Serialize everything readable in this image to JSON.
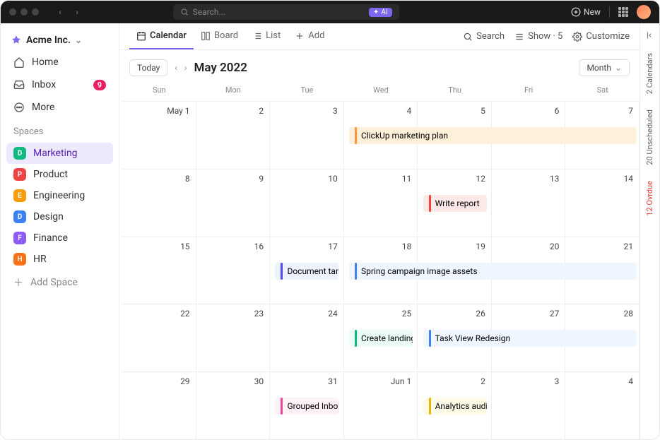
{
  "titlebar": {
    "search_placeholder": "Search...",
    "ai_label": "AI",
    "new_label": "New"
  },
  "workspace": {
    "name": "Acme Inc."
  },
  "sidebar": {
    "items": [
      {
        "label": "Home",
        "icon": "home"
      },
      {
        "label": "Inbox",
        "icon": "inbox",
        "badge": "9"
      },
      {
        "label": "More",
        "icon": "more"
      }
    ],
    "section_label": "Spaces",
    "spaces": [
      {
        "letter": "D",
        "label": "Marketing",
        "color": "#10b981",
        "active": true
      },
      {
        "letter": "P",
        "label": "Product",
        "color": "#ef4444"
      },
      {
        "letter": "E",
        "label": "Engineering",
        "color": "#f59e0b"
      },
      {
        "letter": "D",
        "label": "Design",
        "color": "#3b82f6"
      },
      {
        "letter": "F",
        "label": "Finance",
        "color": "#8b5cf6"
      },
      {
        "letter": "H",
        "label": "HR",
        "color": "#f97316"
      }
    ],
    "add_space": "Add Space"
  },
  "tabs": {
    "items": [
      {
        "label": "Calendar",
        "icon": "calendar",
        "active": true
      },
      {
        "label": "Board",
        "icon": "board"
      },
      {
        "label": "List",
        "icon": "list"
      },
      {
        "label": "Add",
        "icon": "plus"
      }
    ],
    "search": "Search",
    "show": "Show · 5",
    "customize": "Customize"
  },
  "calendar": {
    "today": "Today",
    "title": "May 2022",
    "view": "Month",
    "dow": [
      "Sun",
      "Mon",
      "Tue",
      "Wed",
      "Thu",
      "Fri",
      "Sat"
    ],
    "weeks": [
      [
        "May 1",
        "2",
        "3",
        "4",
        "5",
        "6",
        "7"
      ],
      [
        "8",
        "9",
        "10",
        "11",
        "12",
        "13",
        "14"
      ],
      [
        "15",
        "16",
        "17",
        "18",
        "19",
        "20",
        "21"
      ],
      [
        "22",
        "23",
        "24",
        "25",
        "26",
        "27",
        "28"
      ],
      [
        "29",
        "30",
        "31",
        "Jun 1",
        "2",
        "3",
        "4"
      ]
    ],
    "events": [
      {
        "week": 0,
        "start": 3,
        "span": 4,
        "label": "ClickUp marketing plan",
        "bg": "#fff0d9",
        "bar": "#fb923c"
      },
      {
        "week": 1,
        "start": 4,
        "span": 1,
        "label": "Write report",
        "bg": "#fde8e8",
        "bar": "#ef4444"
      },
      {
        "week": 2,
        "start": 2,
        "span": 1,
        "label": "Document target users",
        "bg": "#eef2ff",
        "bar": "#4f46e5"
      },
      {
        "week": 2,
        "start": 3,
        "span": 4,
        "label": "Spring campaign image assets",
        "bg": "#eff6ff",
        "bar": "#3b82f6"
      },
      {
        "week": 3,
        "start": 3,
        "span": 1,
        "label": "Create landing page",
        "bg": "#ecfdf5",
        "bar": "#10b981"
      },
      {
        "week": 3,
        "start": 4,
        "span": 3,
        "label": "Task View Redesign",
        "bg": "#eff6ff",
        "bar": "#3b82f6"
      },
      {
        "week": 4,
        "start": 2,
        "span": 1,
        "label": "Grouped Inbox Comments",
        "bg": "#fdf2f8",
        "bar": "#ec4899"
      },
      {
        "week": 4,
        "start": 4,
        "span": 1,
        "label": "Analytics audit",
        "bg": "#fefce8",
        "bar": "#eab308"
      }
    ]
  },
  "rail": {
    "calendars": "2 Calendars",
    "unscheduled": "20 Unscheduled",
    "overdue": "12 Ovrdue"
  }
}
